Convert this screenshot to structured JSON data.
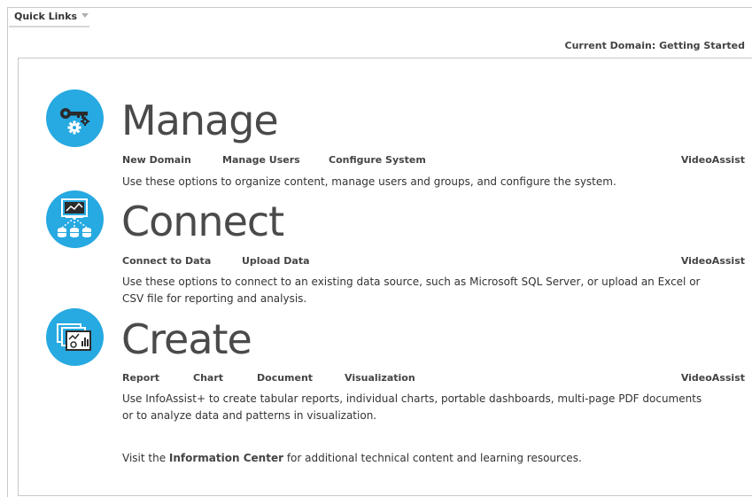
{
  "header": {
    "quick_links_label": "Quick Links",
    "current_domain": "Current Domain: Getting Started"
  },
  "sections": {
    "manage": {
      "title": "Manage",
      "links": [
        "New Domain",
        "Manage Users",
        "Configure System"
      ],
      "video_assist": "VideoAssist",
      "description": "Use these options to organize content, manage users and groups, and configure the system."
    },
    "connect": {
      "title": "Connect",
      "links": [
        "Connect to Data",
        "Upload Data"
      ],
      "video_assist": "VideoAssist",
      "description_line1": "Use these options to connect to an existing data source, such as Microsoft SQL Server, or upload an Excel or",
      "description_line2": "CSV file for reporting and analysis."
    },
    "create": {
      "title": "Create",
      "links": [
        "Report",
        "Chart",
        "Document",
        "Visualization"
      ],
      "video_assist": "VideoAssist",
      "description_line1": "Use InfoAssist+ to create tabular reports, individual charts, portable dashboards, multi-page PDF documents",
      "description_line2": "or to analyze data and patterns in visualization."
    }
  },
  "footer": {
    "prefix": "Visit the ",
    "link": "Information Center",
    "suffix": " for additional technical content and learning resources."
  },
  "colors": {
    "icon_circle": "#27a9e1",
    "icon_glyph": "#ffffff"
  },
  "icons": {
    "manage": "key-gear-icon",
    "connect": "data-connection-icon",
    "create": "dashboard-pages-icon"
  }
}
